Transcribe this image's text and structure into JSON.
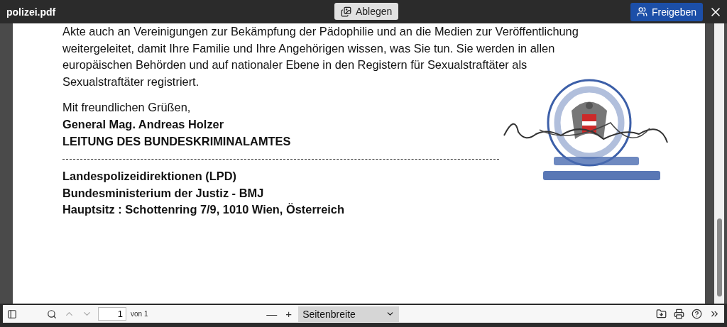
{
  "window": {
    "title": "polizei.pdf"
  },
  "header": {
    "save_button": "Ablegen",
    "share_button": "Freigeben"
  },
  "document": {
    "paragraphs": [
      {
        "kind": "text",
        "text": "Akte auch an Vereinigungen zur Bekämpfung der Pädophilie und an die Medien zur Veröffentlichung weitergeleitet, damit Ihre Familie und Ihre Angehörigen wissen, was Sie tun. Sie werden in allen europäischen Behörden und auf nationaler Ebene in den Registern für Sexualstraftäter als Sexualstraftäter registriert."
      },
      {
        "kind": "text",
        "text": "Mit freundlichen Grüßen,"
      },
      {
        "kind": "bold",
        "text": "General Mag. Andreas Holzer"
      },
      {
        "kind": "bold",
        "text": "LEITUNG DES BUNDESKRIMINALAMTES"
      },
      {
        "kind": "rule"
      },
      {
        "kind": "bold",
        "text": "Landespolizeidirektionen (LPD)"
      },
      {
        "kind": "bold",
        "text": "Bundesministerium der Justiz - BMJ"
      },
      {
        "kind": "bold",
        "text": "Hauptsitz : Schottenring 7/9, 1010 Wien, Österreich"
      }
    ]
  },
  "toolbar": {
    "page_input": "1",
    "page_count": "von 1",
    "zoom_minus": "—",
    "zoom_plus": "+",
    "zoom_select": "Seitenbreite"
  }
}
